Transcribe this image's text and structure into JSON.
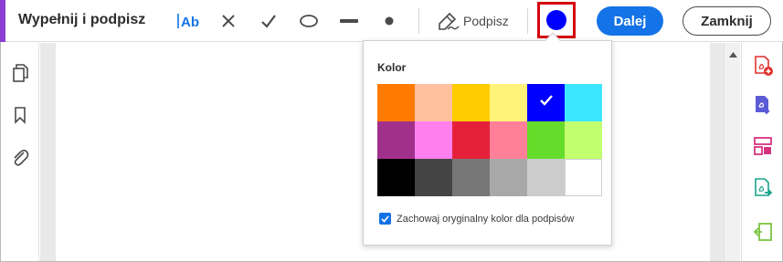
{
  "toolbar": {
    "title": "Wypełnij i podpisz",
    "accent_color": "#8a3fd1",
    "tools": [
      {
        "name": "add-text-tool",
        "icon": "text-field-icon"
      },
      {
        "name": "cross-mark-tool",
        "icon": "cross-icon"
      },
      {
        "name": "checkmark-tool",
        "icon": "checkmark-icon"
      },
      {
        "name": "ellipse-tool",
        "icon": "ellipse-icon"
      },
      {
        "name": "line-tool",
        "icon": "line-icon"
      },
      {
        "name": "dot-tool",
        "icon": "dot-icon"
      }
    ],
    "sign_label": "Podpisz",
    "selected_color": "#0000ff",
    "next_label": "Dalej",
    "close_label": "Zamknij"
  },
  "left_rail": [
    {
      "name": "page-thumbnails-icon"
    },
    {
      "name": "bookmark-icon"
    },
    {
      "name": "attachment-icon"
    }
  ],
  "right_rail": [
    {
      "name": "create-pdf-icon",
      "color": "#e0312b"
    },
    {
      "name": "export-pdf-icon",
      "color": "#5b5bd6"
    },
    {
      "name": "organize-pages-icon",
      "color": "#d6337f"
    },
    {
      "name": "send-for-review-icon",
      "color": "#18a58b"
    },
    {
      "name": "compress-pdf-icon",
      "color": "#7bc442"
    }
  ],
  "color_popup": {
    "heading": "Kolor",
    "swatches": [
      [
        "#ff7a00",
        "#ffc09f",
        "#ffcc00",
        "#fff37a",
        "#0000ff",
        "#3de6ff"
      ],
      [
        "#a1308b",
        "#ff7fef",
        "#e5213a",
        "#ff7f99",
        "#66dc2a",
        "#c2ff6e"
      ],
      [
        "#000000",
        "#444444",
        "#777777",
        "#a8a8a8",
        "#cccccc",
        "#ffffff"
      ]
    ],
    "selected_swatch": "#0000ff",
    "keep_original_color_label": "Zachowaj oryginalny kolor dla podpisów",
    "keep_original_color_checked": true
  }
}
